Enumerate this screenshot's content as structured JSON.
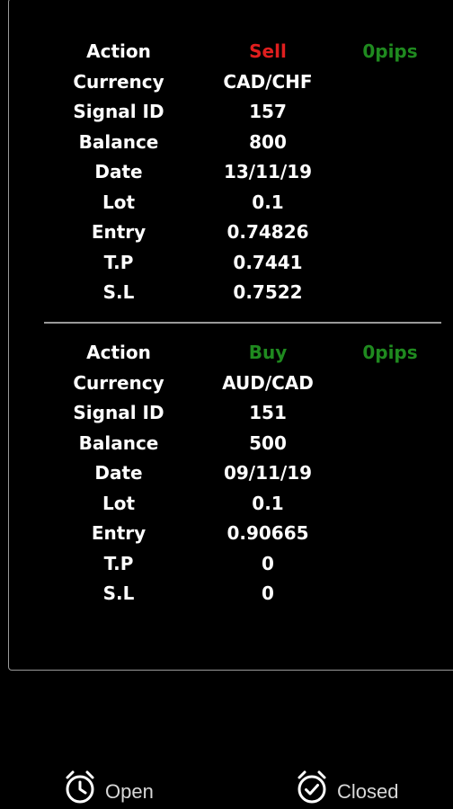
{
  "signals": [
    {
      "rows": [
        {
          "label": "Action",
          "value": "Sell",
          "extra": "0pips"
        },
        {
          "label": "Currency",
          "value": "CAD/CHF"
        },
        {
          "label": "Signal ID",
          "value": "157"
        },
        {
          "label": "Balance",
          "value": "800"
        },
        {
          "label": "Date",
          "value": "13/11/19"
        },
        {
          "label": "Lot",
          "value": "0.1"
        },
        {
          "label": "Entry",
          "value": "0.74826"
        },
        {
          "label": "T.P",
          "value": "0.7441"
        },
        {
          "label": "S.L",
          "value": "0.7522"
        }
      ]
    },
    {
      "rows": [
        {
          "label": "Action",
          "value": "Buy",
          "extra": "0pips"
        },
        {
          "label": "Currency",
          "value": "AUD/CAD"
        },
        {
          "label": "Signal ID",
          "value": "151"
        },
        {
          "label": "Balance",
          "value": "500"
        },
        {
          "label": "Date",
          "value": "09/11/19"
        },
        {
          "label": "Lot",
          "value": "0.1"
        },
        {
          "label": "Entry",
          "value": "0.90665"
        },
        {
          "label": "T.P",
          "value": "0"
        },
        {
          "label": "S.L",
          "value": "0"
        }
      ]
    }
  ],
  "colors": {
    "sell": "#e01e1e",
    "buy": "#1f8a1f",
    "pips": "#1f8a1f",
    "background": "#000000",
    "text": "#ffffff"
  },
  "bottom_nav": {
    "open": {
      "label": "Open",
      "icon": "alarm-clock-icon"
    },
    "closed": {
      "label": "Closed",
      "icon": "alarm-check-icon"
    }
  }
}
